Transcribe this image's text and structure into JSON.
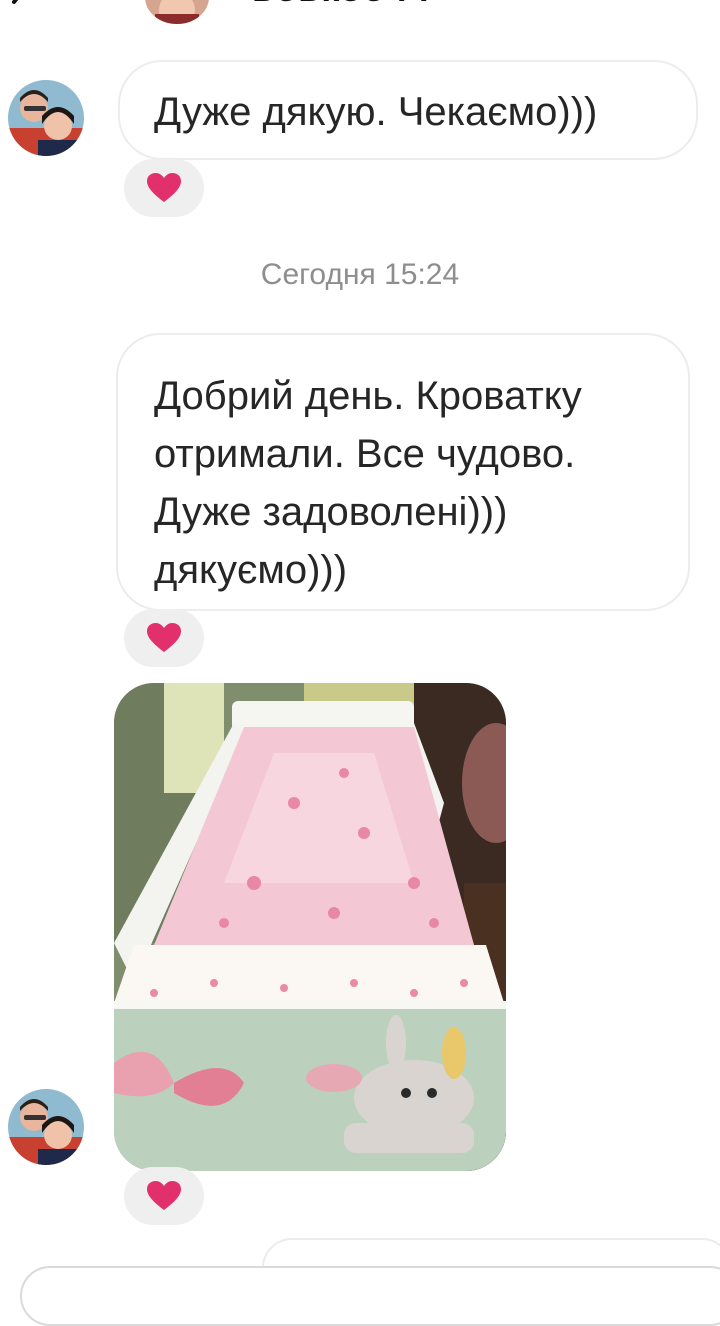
{
  "header": {
    "username": "ьоькоо i i",
    "back_icon": "chevron-left-icon",
    "video_icon": "video-call-icon",
    "info_icon": "info-icon"
  },
  "messages": [
    {
      "text": "Дуже дякую. Чекаємо)))",
      "reaction": "heart-icon"
    },
    {
      "text": "Добрий день. Кроватку отримали. Все чудово. Дуже задоволені))) дякуємо)))",
      "reaction": "heart-icon"
    },
    {
      "type": "photo",
      "reaction": "heart-icon"
    }
  ],
  "timestamp": "Сегодня 15:24",
  "colors": {
    "reaction_heart": "#e1306c",
    "bubble_border": "#ececec",
    "timestamp": "#8e8e8e",
    "reaction_bg": "#efefef"
  }
}
